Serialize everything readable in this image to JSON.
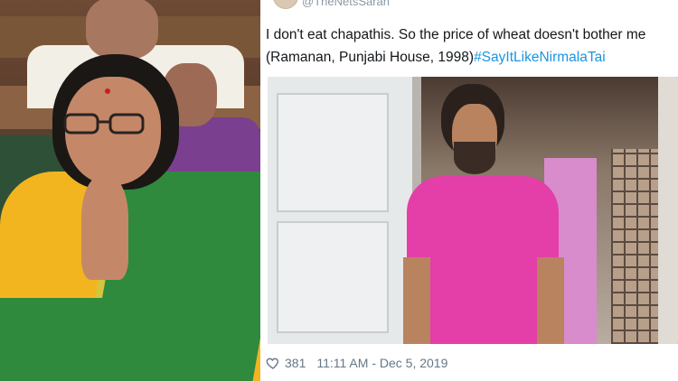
{
  "tweet": {
    "handle": "@TheNetsSarah",
    "text_line1": "I don't eat chapathis. So the price of wheat doesn't bother me",
    "text_line2_prefix": "(Ramanan, Punjabi House, 1998)",
    "hashtag": "#SayItLikeNirmalaTai",
    "likes": "381",
    "timestamp": "11:11 AM - Dec 5, 2019"
  },
  "icons": {
    "like": "heart-outline-icon"
  },
  "colors": {
    "hashtag": "#1b95e0",
    "meta_text": "#657786",
    "shirt_pink": "#e43ea8",
    "saree_green": "#2f8a3d",
    "blouse_yellow": "#f2b520"
  }
}
